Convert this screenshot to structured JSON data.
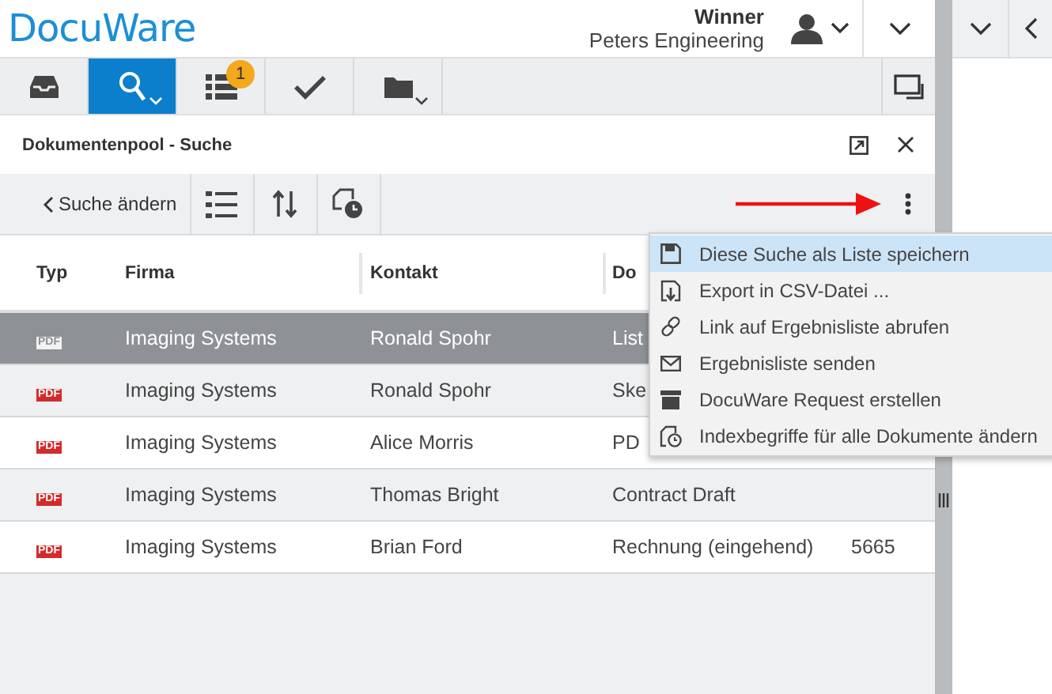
{
  "header": {
    "logo": "DocuWare",
    "user_name": "Winner",
    "organization": "Peters Engineering"
  },
  "toolbar": {
    "tabs": [
      {
        "kind": "inbox",
        "selected": false,
        "dropdown": false
      },
      {
        "kind": "search",
        "selected": true,
        "dropdown": true
      },
      {
        "kind": "lists",
        "selected": false,
        "dropdown": false,
        "badge": "1"
      },
      {
        "kind": "tasks",
        "selected": false,
        "dropdown": false
      },
      {
        "kind": "folder",
        "selected": false,
        "dropdown": true
      }
    ]
  },
  "panel": {
    "title": "Dokumentenpool - Suche",
    "back_label": "Suche ändern"
  },
  "table": {
    "columns": [
      "Typ",
      "Firma",
      "Kontakt",
      "Do"
    ],
    "rows": [
      {
        "selected": true,
        "cells": [
          "PDF",
          "Imaging Systems",
          "Ronald Spohr",
          "List"
        ]
      },
      {
        "selected": false,
        "cells": [
          "PDF",
          "Imaging Systems",
          "Ronald Spohr",
          "Ske"
        ]
      },
      {
        "selected": false,
        "cells": [
          "PDF",
          "Imaging Systems",
          "Alice Morris",
          "PD"
        ]
      },
      {
        "selected": false,
        "cells": [
          "PDF",
          "Imaging Systems",
          "Thomas Bright",
          "Contract Draft"
        ]
      },
      {
        "selected": false,
        "cells": [
          "PDF",
          "Imaging Systems",
          "Brian Ford",
          "Rechnung (eingehend)",
          "5665"
        ]
      }
    ]
  },
  "menu": {
    "items": [
      {
        "kind": "save",
        "label": "Diese Suche als Liste speichern",
        "selected": true
      },
      {
        "kind": "export",
        "label": "Export in CSV-Datei ...",
        "selected": false
      },
      {
        "kind": "link",
        "label": "Link auf Ergebnisliste abrufen",
        "selected": false
      },
      {
        "kind": "mail",
        "label": "Ergebnisliste senden",
        "selected": false
      },
      {
        "kind": "request",
        "label": "DocuWare Request erstellen",
        "selected": false
      },
      {
        "kind": "index",
        "label": "Indexbegriffe für alle Dokumente ändern",
        "selected": false
      }
    ]
  }
}
